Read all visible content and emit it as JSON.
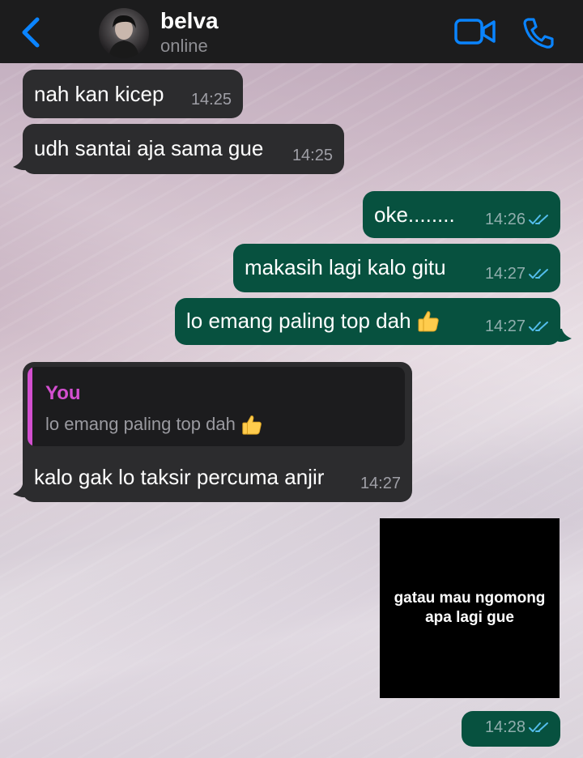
{
  "header": {
    "contact_name": "belva",
    "contact_status": "online"
  },
  "messages": [
    {
      "direction": "incoming",
      "text": "nah kan kicep",
      "time": "14:25"
    },
    {
      "direction": "incoming",
      "text": "udh santai aja sama gue",
      "time": "14:25"
    },
    {
      "direction": "outgoing",
      "text": "oke........",
      "time": "14:26",
      "status": "read"
    },
    {
      "direction": "outgoing",
      "text": "makasih lagi kalo gitu",
      "time": "14:27",
      "status": "read"
    },
    {
      "direction": "outgoing",
      "text": "lo emang paling top dah",
      "emoji": "thumbs-up",
      "time": "14:27",
      "status": "read"
    },
    {
      "direction": "incoming",
      "reply_author": "You",
      "reply_text": "lo emang paling top dah",
      "reply_emoji": "thumbs-up",
      "text": "kalo gak lo taksir percuma anjir",
      "time": "14:27"
    },
    {
      "direction": "outgoing",
      "type": "image",
      "image_text": "gatau mau ngomong apa lagi gue",
      "time": "14:28",
      "status": "read"
    }
  ],
  "colors": {
    "header_bg": "#1c1c1d",
    "accent": "#0a84ff",
    "incoming_bubble": "#2c2c2e",
    "outgoing_bubble": "#07513f",
    "reply_author": "#d34fd0",
    "read_ticks": "#53bdeb"
  },
  "icons": [
    "chevron-left-icon",
    "video-call-icon",
    "phone-icon",
    "double-check-icon",
    "thumbs-up-emoji"
  ]
}
